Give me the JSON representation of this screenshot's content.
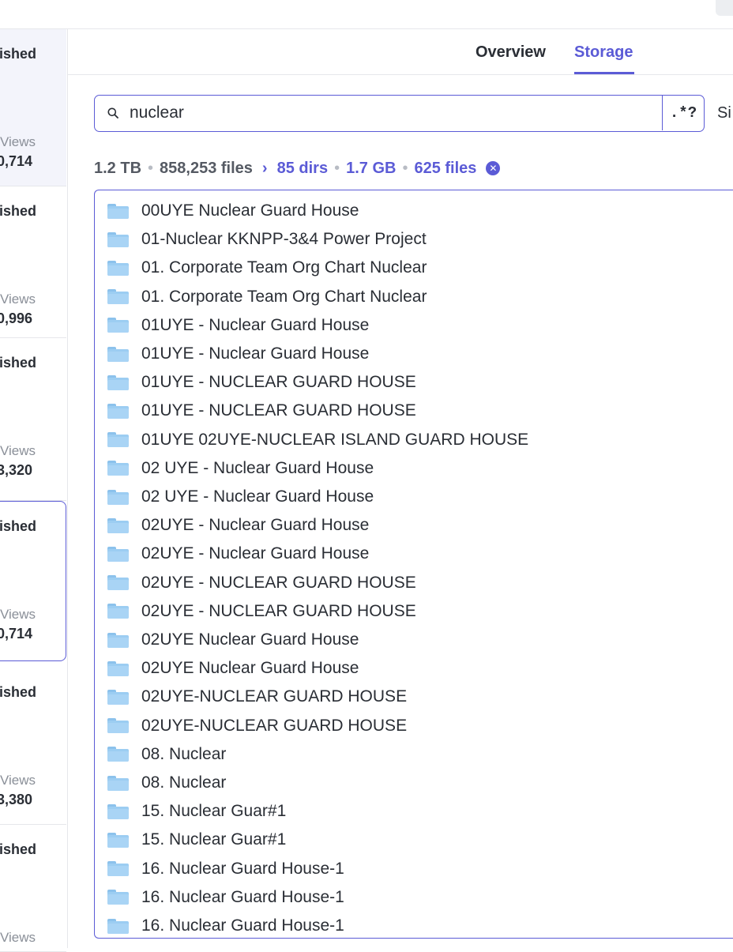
{
  "sidebar": {
    "cards": [
      {
        "published": "lished",
        "views_label": "Views",
        "views": "0,714"
      },
      {
        "published": "lished",
        "views_label": "Views",
        "views": "0,996"
      },
      {
        "published": "lished",
        "views_label": "Views",
        "views": "3,320"
      },
      {
        "published": "lished",
        "views_label": "Views",
        "views": "0,714"
      },
      {
        "published": "lished",
        "views_label": "Views",
        "views": "3,380"
      },
      {
        "published": "lished",
        "views_label": "Views",
        "views": ""
      }
    ]
  },
  "tabs": [
    {
      "label": "Overview",
      "active": false
    },
    {
      "label": "Storage",
      "active": true
    }
  ],
  "search": {
    "value": "nuclear",
    "regex_label": ".*?",
    "size_label": "Si"
  },
  "stats": {
    "total_size": "1.2 TB",
    "total_files": "858,253 files",
    "dirs": "85 dirs",
    "filtered_size": "1.7 GB",
    "filtered_files": "625 files"
  },
  "colors": {
    "accent": "#5b5bd6",
    "folder": "#9ccdf2"
  },
  "folders": [
    "00UYE Nuclear Guard House",
    "01-Nuclear KKNPP-3&4 Power Project",
    "01. Corporate Team Org Chart Nuclear",
    "01. Corporate Team Org Chart Nuclear",
    "01UYE - Nuclear Guard House",
    "01UYE - Nuclear Guard House",
    "01UYE - NUCLEAR GUARD HOUSE",
    "01UYE - NUCLEAR GUARD HOUSE",
    "01UYE 02UYE-NUCLEAR ISLAND GUARD HOUSE",
    "02 UYE - Nuclear Guard House",
    "02 UYE - Nuclear Guard House",
    "02UYE - Nuclear Guard House",
    "02UYE - Nuclear Guard House",
    "02UYE - NUCLEAR GUARD HOUSE",
    "02UYE - NUCLEAR GUARD HOUSE",
    "02UYE Nuclear Guard House",
    "02UYE Nuclear Guard House",
    "02UYE-NUCLEAR GUARD HOUSE",
    "02UYE-NUCLEAR GUARD HOUSE",
    "08. Nuclear",
    "08. Nuclear",
    "15. Nuclear Guar#1",
    "15. Nuclear Guar#1",
    "16. Nuclear Guard House-1",
    "16. Nuclear Guard House-1",
    "16. Nuclear Guard House-1"
  ]
}
